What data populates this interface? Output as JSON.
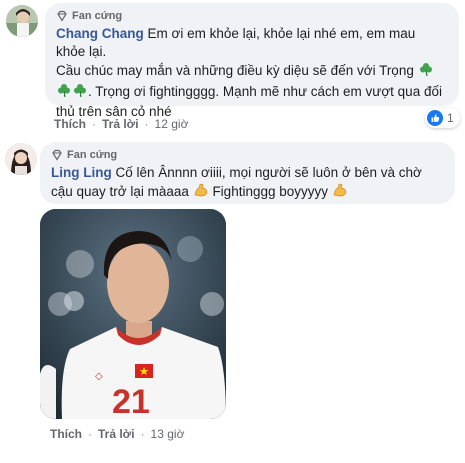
{
  "comments": [
    {
      "badge": "Fan cứng",
      "author": "Chang Chang",
      "text1": " Em ơi em khỏe lại, khỏe lại nhé em, em mau khỏe lại.",
      "text2a": "Cầu chúc may mắn và những điều kỳ diệu sẽ đến với Trọng ",
      "text2b": ". Trọng ơi fightingggg. Mạnh mẽ như cách em vượt qua đối thủ trên sân cỏ nhé",
      "like_label": "Thích",
      "reply_label": "Trả lời",
      "time": "12 giờ",
      "reaction_count": "1",
      "reaction_icon": "thumbs-up-icon",
      "accent": "#385898"
    },
    {
      "badge": "Fan cứng",
      "author": "Ling Ling",
      "text1": " Cố lên Ânnnn ơiiii, mọi người sẽ luôn ở bên và chờ cậu quay trở lại màaaa ",
      "text2": " Fightinggg boyyyyy ",
      "like_label": "Thích",
      "reply_label": "Trả lời",
      "time": "13 giờ",
      "photo_jersey_number": "21"
    }
  ]
}
